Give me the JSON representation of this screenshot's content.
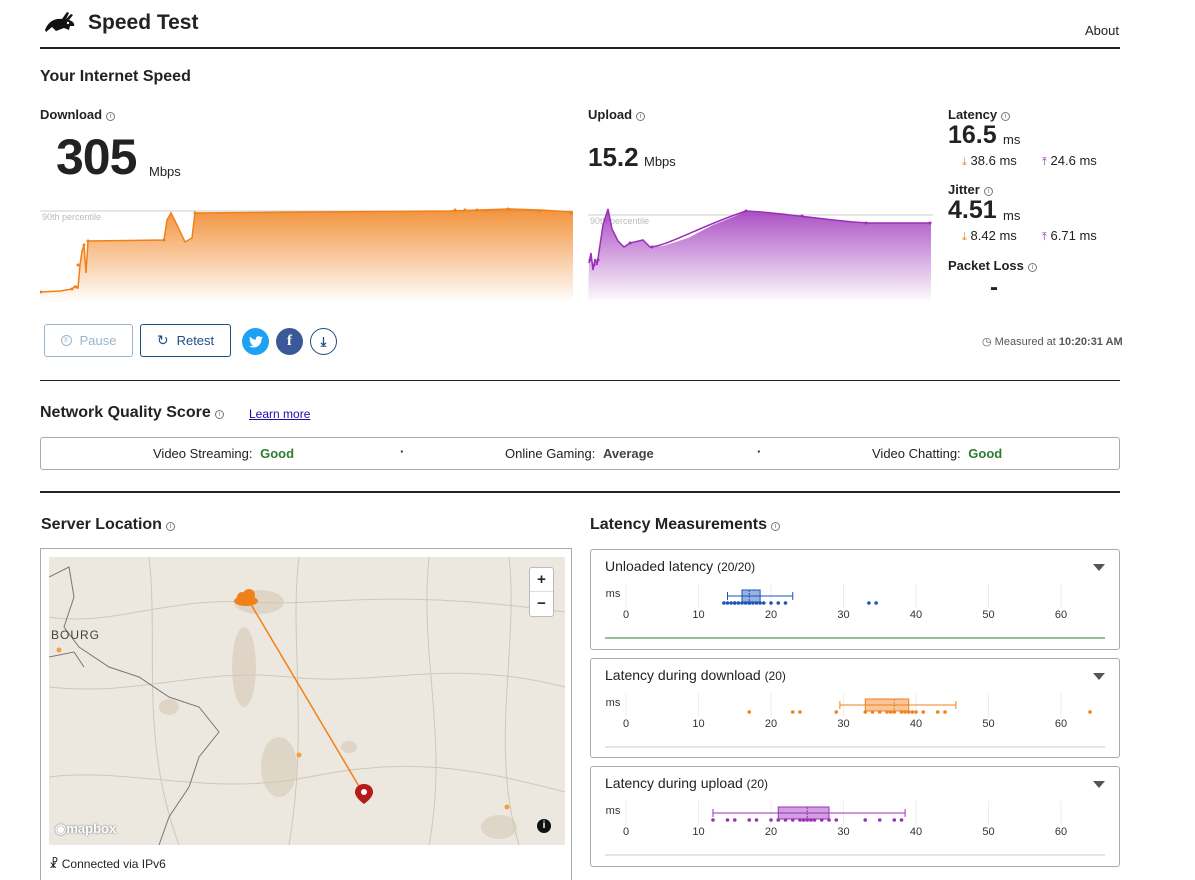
{
  "header": {
    "title": "Speed Test",
    "about": "About"
  },
  "speed": {
    "title": "Your Internet Speed",
    "download": {
      "label": "Download",
      "value": "305",
      "unit": "Mbps",
      "percentile": "90th percentile"
    },
    "upload": {
      "label": "Upload",
      "value": "15.2",
      "unit": "Mbps",
      "percentile": "90th percentile"
    },
    "latency": {
      "label": "Latency",
      "value": "16.5",
      "unit": "ms",
      "down": "38.6",
      "up": "24.6",
      "sub_unit": "ms"
    },
    "jitter": {
      "label": "Jitter",
      "value": "4.51",
      "unit": "ms",
      "down": "8.42",
      "up": "6.71",
      "sub_unit": "ms"
    },
    "packet_loss": {
      "label": "Packet Loss",
      "value": "-"
    }
  },
  "actions": {
    "pause": "Pause",
    "retest": "Retest",
    "measured_prefix": "Measured at",
    "measured_time": "10:20:31 AM"
  },
  "quality": {
    "title": "Network Quality Score",
    "learn_more": "Learn more",
    "items": [
      {
        "label": "Video Streaming:",
        "value": "Good"
      },
      {
        "label": "Online Gaming:",
        "value": "Average"
      },
      {
        "label": "Video Chatting:",
        "value": "Good"
      }
    ]
  },
  "server": {
    "title": "Server Location",
    "map_label": "BOURG",
    "mapbox": "mapbox",
    "zoom_in": "+",
    "zoom_out": "−",
    "connected": "Connected via IPv6"
  },
  "latency_meas": {
    "title": "Latency Measurements",
    "axis_unit": "ms",
    "cards": [
      {
        "title": "Unloaded latency",
        "count": "(20/20)",
        "color": "#1a56b8"
      },
      {
        "title": "Latency during download",
        "count": "(20)",
        "color": "#f0801a"
      },
      {
        "title": "Latency during upload",
        "count": "(20)",
        "color": "#9a2fb8"
      }
    ]
  },
  "colors": {
    "download": "#f0801a",
    "upload": "#9a2fb8",
    "good": "#2e7d32",
    "accent": "#1c4f83"
  }
}
